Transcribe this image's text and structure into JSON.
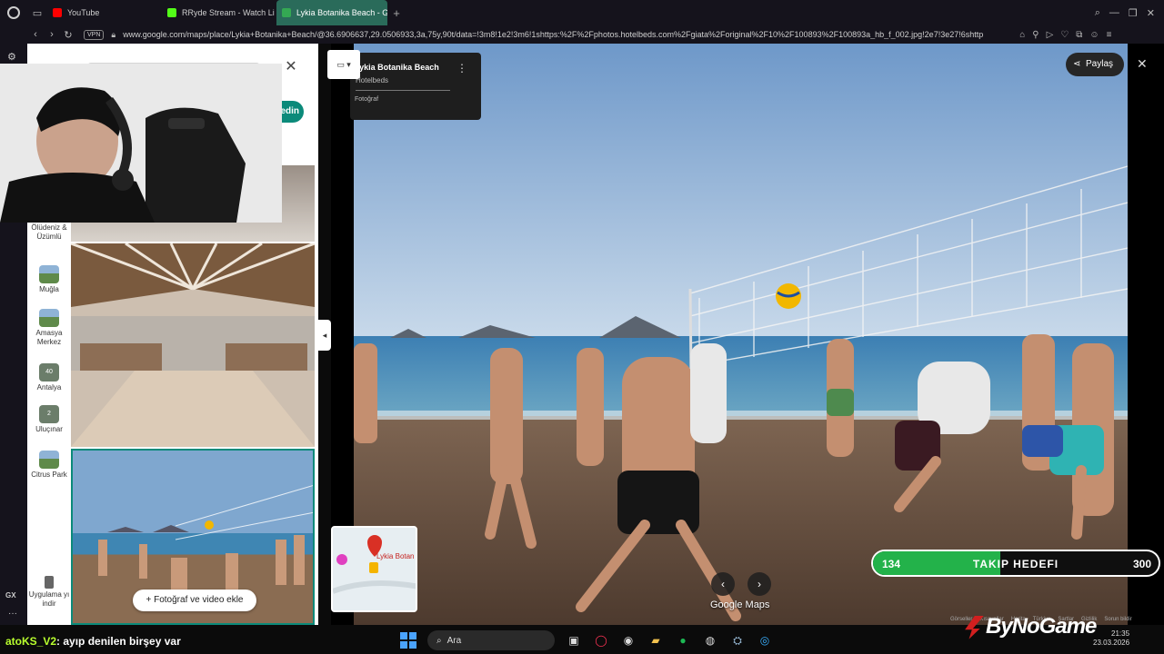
{
  "browser": {
    "tabs": [
      {
        "title": "YouTube",
        "favicon_color": "#ff0000"
      },
      {
        "title": "RRyde Stream - Watch Li",
        "favicon_color": "#53fc18"
      },
      {
        "title": "Lykia Botanika Beach - Go",
        "favicon_color": "#34a853"
      }
    ],
    "new_tab": "+",
    "nav": {
      "back": "‹",
      "forward": "›",
      "reload": "↻"
    },
    "vpn_label": "VPN",
    "url": "www.google.com/maps/place/Lykia+Botanika+Beach/@36.6906637,29.0506933,3a,75y,90t/data=!3m8!1e2!3m6!1shttps:%2F%2Fphotos.hotelbeds.com%2Fgiata%2Foriginal%2F10%2F100893%2F100893a_hb_f_002.jpg!2e7!3e27!6shttp",
    "sidebar_label": "GX",
    "sidebar_more": "···"
  },
  "maps": {
    "recent": [
      {
        "label": "Ölüdeniz & Üzümlü"
      },
      {
        "label": "Muğla"
      },
      {
        "label": "Amasya Merkez"
      },
      {
        "label": "Antalya",
        "badge": "40"
      },
      {
        "label": "Uluçınar",
        "badge": "2"
      },
      {
        "label": "Citrus Park"
      },
      {
        "label": "Uygulama yı indir"
      }
    ],
    "directions_partial": "edin",
    "add_photo_label": "Fotoğraf ve video ekle"
  },
  "viewer": {
    "place_title": "Lykia Botanika Beach",
    "provider": "Hotelbeds",
    "type_label": "Fotoğraf",
    "share_label": "Paylaş",
    "brand_label": "Google Maps",
    "mini_map_label": "Lykia Botan",
    "footer_links": [
      "Görseller",
      "Kısayollar",
      "Harita",
      "Türkiye",
      "Şartlar",
      "Gizlilik",
      "Sorun bildir"
    ]
  },
  "stream": {
    "goal": {
      "current": 134,
      "title": "TAKIP HEDEFI",
      "target": 300
    },
    "brand": "ByNoGame",
    "chat": {
      "user": "atoKS_V2",
      "message": ": ayıp denilen birşey var"
    }
  },
  "taskbar": {
    "search_placeholder": "Ara",
    "time": "21:35",
    "date": "23.03.2026"
  }
}
